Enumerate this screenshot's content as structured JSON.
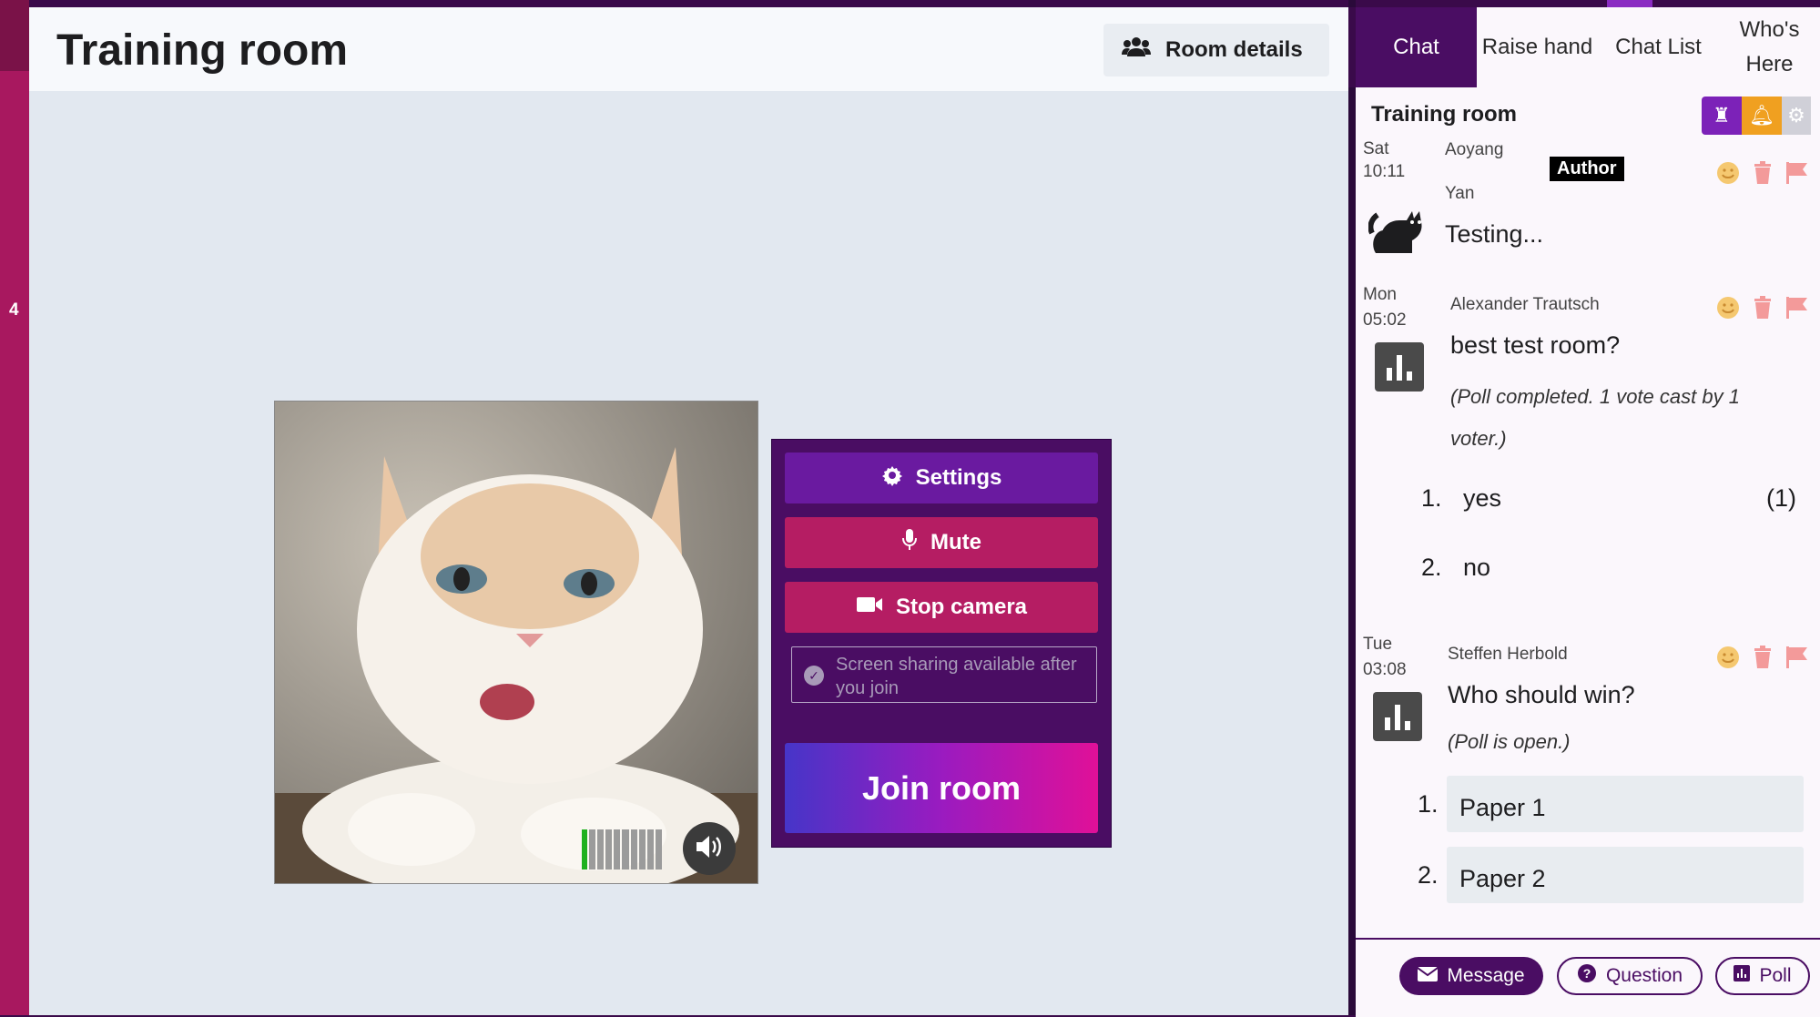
{
  "sidebar": {
    "badge_number": "4"
  },
  "header": {
    "title": "Training room",
    "room_details_label": "Room details"
  },
  "controls": {
    "settings_label": "Settings",
    "mute_label": "Mute",
    "stop_camera_label": "Stop camera",
    "screen_sharing_note": "Screen sharing available after you join",
    "join_label": "Join room"
  },
  "audio": {
    "level": 0.1
  },
  "tabs": [
    {
      "label": "Chat",
      "active": true
    },
    {
      "label": "Raise hand"
    },
    {
      "label": "Chat List"
    },
    {
      "label": "Who's Here"
    }
  ],
  "panel": {
    "title": "Training room"
  },
  "messages": [
    {
      "date_line1": "Sat",
      "date_line2": "10:11",
      "author_line1": "Aoyang",
      "author_line2": "Yan",
      "badge": "Author",
      "text": "Testing..."
    },
    {
      "date_line1": "Mon",
      "date_line2": "05:02",
      "author": "Alexander Trautsch",
      "text": "best test room?",
      "meta": "(Poll completed. 1 vote cast by 1 voter.)",
      "options": [
        {
          "num": "1.",
          "label": "yes",
          "count": "(1)"
        },
        {
          "num": "2.",
          "label": "no",
          "count": ""
        }
      ]
    },
    {
      "date_line1": "Tue",
      "date_line2": "03:08",
      "author": "Steffen Herbold",
      "text": "Who should win?",
      "meta": "(Poll is open.)",
      "options": [
        {
          "num": "1.",
          "label": "Paper 1"
        },
        {
          "num": "2.",
          "label": "Paper 2"
        }
      ]
    }
  ],
  "footer": {
    "message_label": "Message",
    "question_label": "Question",
    "poll_label": "Poll"
  },
  "colors": {
    "primary": "#4a0d63",
    "accent": "#b51d63",
    "warning": "#f0a020"
  }
}
